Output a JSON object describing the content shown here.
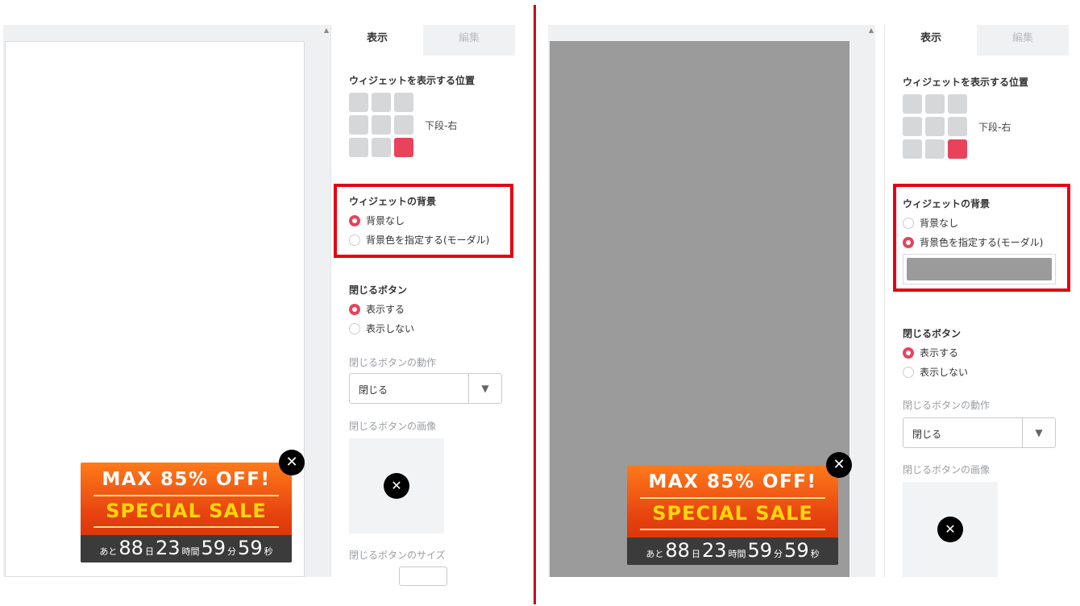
{
  "tabs": {
    "display": "表示",
    "edit": "編集"
  },
  "position": {
    "label": "ウィジェットを表示する位置",
    "value": "下段-右"
  },
  "background": {
    "label": "ウィジェットの背景",
    "option_none": "背景なし",
    "option_color": "背景色を指定する(モーダル)"
  },
  "close_button": {
    "label": "閉じるボタン",
    "show": "表示する",
    "hide": "表示しない",
    "action_label": "閉じるボタンの動作",
    "action_value": "閉じる",
    "image_label": "閉じるボタンの画像",
    "size_label": "閉じるボタンのサイズ"
  },
  "banner": {
    "headline": "MAX 85% OFF!",
    "subline": "SPECIAL SALE",
    "prefix": "あと",
    "days": "88",
    "days_unit": "日",
    "hours": "23",
    "hours_unit": "時間",
    "minutes": "59",
    "minutes_unit": "分",
    "seconds": "59",
    "seconds_unit": "秒"
  },
  "icons": {
    "close": "close-icon",
    "dropdown": "chevron-down-icon",
    "scroll": "scroll-up-icon"
  },
  "colors": {
    "accent": "#e8435a",
    "highlight": "#e60012",
    "modal_bg": "#9b9b9b",
    "divider": "#c0101a"
  },
  "left_state": {
    "background_selected": "none",
    "close_selected": "show"
  },
  "right_state": {
    "background_selected": "color",
    "close_selected": "show"
  }
}
